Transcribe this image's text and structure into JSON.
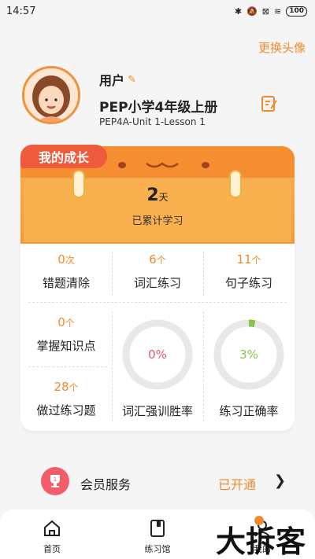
{
  "status_bar": {
    "time": "14:57",
    "battery": "100"
  },
  "header": {
    "change_avatar": "更换头像"
  },
  "profile": {
    "username": "用户",
    "book": "PEP小学4年级上册",
    "lesson": "PEP4A-Unit 1-Lesson 1"
  },
  "growth": {
    "tab_title": "我的成长",
    "days_value": "2",
    "days_unit": "天",
    "days_label": "已累计学习"
  },
  "stats": {
    "wrong": {
      "value": "0",
      "unit": "次",
      "label": "错题清除"
    },
    "vocab": {
      "value": "6",
      "unit": "个",
      "label": "词汇练习"
    },
    "sentence": {
      "value": "11",
      "unit": "个",
      "label": "句子练习"
    },
    "mastered": {
      "value": "0",
      "unit": "个",
      "label": "掌握知识点"
    },
    "done": {
      "value": "28",
      "unit": "个",
      "label": "做过练习题"
    }
  },
  "gauges": {
    "vocab_win": {
      "text": "0%",
      "percent": 0,
      "label": "词汇强训胜率",
      "color": "#e05a6a"
    },
    "accuracy": {
      "text": "3%",
      "percent": 3,
      "label": "练习正确率",
      "color": "#8bc34a"
    }
  },
  "member": {
    "label": "会员服务",
    "status": "已开通",
    "trophy_number": "1"
  },
  "tabbar": {
    "home": "首页",
    "practice": "练习馆",
    "mine": "我的"
  },
  "watermark": "大拆客",
  "colors": {
    "accent": "#f08a2e",
    "tab_red": "#ee5b3c"
  }
}
